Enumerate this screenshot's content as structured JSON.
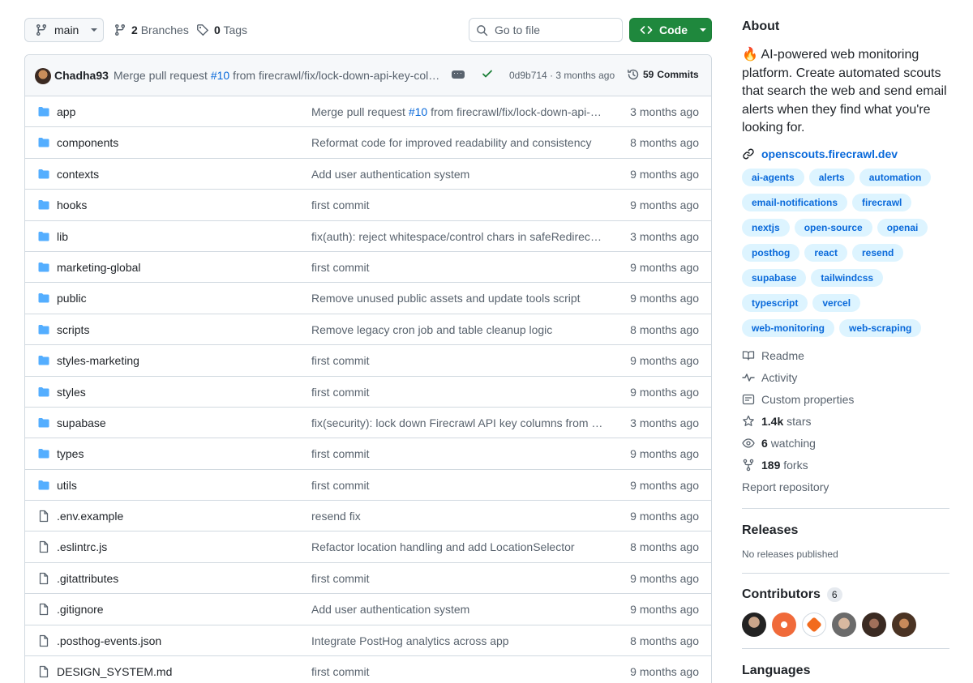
{
  "toolbar": {
    "branch_label": "main",
    "branches_count": "2",
    "branches_label": "Branches",
    "tags_count": "0",
    "tags_label": "Tags",
    "goto_placeholder": "Go to file",
    "code_label": "Code"
  },
  "latest_commit": {
    "author": "Chadha93",
    "message_prefix": "Merge pull request",
    "pr": "#10",
    "message_suffix": "from firecrawl/fix/lock-down-api-key-colu…",
    "sha": "0d9b714",
    "sep": "·",
    "age": "3 months ago",
    "commits_count": "59",
    "commits_label": "Commits"
  },
  "files": [
    {
      "type": "dir",
      "name": "app",
      "msg_prefix": "Merge pull request ",
      "pr": "#10",
      "msg": " from firecrawl/fix/lock-down-api-k…",
      "age": "3 months ago"
    },
    {
      "type": "dir",
      "name": "components",
      "msg": "Reformat code for improved readability and consistency",
      "age": "8 months ago"
    },
    {
      "type": "dir",
      "name": "contexts",
      "msg": "Add user authentication system",
      "age": "9 months ago"
    },
    {
      "type": "dir",
      "name": "hooks",
      "msg": "first commit",
      "age": "9 months ago"
    },
    {
      "type": "dir",
      "name": "lib",
      "msg": "fix(auth): reject whitespace/control chars in safeRedirectP…",
      "age": "3 months ago"
    },
    {
      "type": "dir",
      "name": "marketing-global",
      "msg": "first commit",
      "age": "9 months ago"
    },
    {
      "type": "dir",
      "name": "public",
      "msg": "Remove unused public assets and update tools script",
      "age": "9 months ago"
    },
    {
      "type": "dir",
      "name": "scripts",
      "msg": "Remove legacy cron job and table cleanup logic",
      "age": "8 months ago"
    },
    {
      "type": "dir",
      "name": "styles-marketing",
      "msg": "first commit",
      "age": "9 months ago"
    },
    {
      "type": "dir",
      "name": "styles",
      "msg": "first commit",
      "age": "9 months ago"
    },
    {
      "type": "dir",
      "name": "supabase",
      "msg": "fix(security): lock down Firecrawl API key columns from br…",
      "age": "3 months ago"
    },
    {
      "type": "dir",
      "name": "types",
      "msg": "first commit",
      "age": "9 months ago"
    },
    {
      "type": "dir",
      "name": "utils",
      "msg": "first commit",
      "age": "9 months ago"
    },
    {
      "type": "file",
      "name": ".env.example",
      "msg": "resend fix",
      "age": "9 months ago"
    },
    {
      "type": "file",
      "name": ".eslintrc.js",
      "msg": "Refactor location handling and add LocationSelector",
      "age": "8 months ago"
    },
    {
      "type": "file",
      "name": ".gitattributes",
      "msg": "first commit",
      "age": "9 months ago"
    },
    {
      "type": "file",
      "name": ".gitignore",
      "msg": "Add user authentication system",
      "age": "9 months ago"
    },
    {
      "type": "file",
      "name": ".posthog-events.json",
      "msg": "Integrate PostHog analytics across app",
      "age": "8 months ago"
    },
    {
      "type": "file",
      "name": "DESIGN_SYSTEM.md",
      "msg": "first commit",
      "age": "9 months ago"
    }
  ],
  "about": {
    "heading": "About",
    "emoji": "🔥",
    "description": "AI-powered web monitoring platform. Create automated scouts that search the web and send email alerts when they find what you're looking for.",
    "website": "openscouts.firecrawl.dev",
    "topics": [
      "ai-agents",
      "alerts",
      "automation",
      "email-notifications",
      "firecrawl",
      "nextjs",
      "open-source",
      "openai",
      "posthog",
      "react",
      "resend",
      "supabase",
      "tailwindcss",
      "typescript",
      "vercel",
      "web-monitoring",
      "web-scraping"
    ],
    "readme": "Readme",
    "activity": "Activity",
    "custom_properties": "Custom properties",
    "stars_count": "1.4k",
    "stars_label": "stars",
    "watching_count": "6",
    "watching_label": "watching",
    "forks_count": "189",
    "forks_label": "forks",
    "report": "Report repository"
  },
  "releases": {
    "heading": "Releases",
    "empty": "No releases published"
  },
  "contributors": {
    "heading": "Contributors",
    "count": "6"
  },
  "languages": {
    "heading": "Languages"
  },
  "colors": {
    "accent": "#0969da",
    "success": "#1f883d",
    "folder": "#54aeff",
    "muted": "#59636e"
  }
}
